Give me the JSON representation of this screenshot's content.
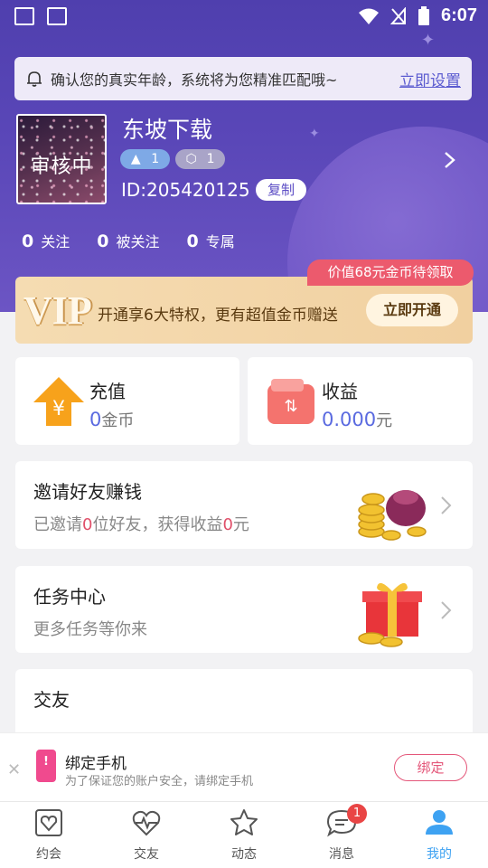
{
  "status_bar": {
    "time": "6:07"
  },
  "notice": {
    "text": "确认您的真实年龄，系统将为您精准匹配哦~",
    "link": "立即设置"
  },
  "profile": {
    "avatar_text": "审核中",
    "name": "东坡下载",
    "badge1": "1",
    "badge2": "1",
    "id": "ID:205420125",
    "copy": "复制"
  },
  "stats": [
    {
      "value": "0",
      "label": "关注"
    },
    {
      "value": "0",
      "label": "被关注"
    },
    {
      "value": "0",
      "label": "专属"
    }
  ],
  "vip": {
    "tag": "价值68元金币待领取",
    "logo": "VIP",
    "text": "开通享6大特权，更有超值金币赠送",
    "button": "立即开通"
  },
  "recharge": {
    "title": "充值",
    "value": "0",
    "unit": "金币"
  },
  "income": {
    "title": "收益",
    "value": "0.000",
    "unit": "元"
  },
  "invite": {
    "title": "邀请好友赚钱",
    "prefix": "已邀请",
    "count": "0",
    "mid": "位好友，获得收益",
    "amount": "0",
    "suffix": "元"
  },
  "task": {
    "title": "任务中心",
    "subtitle": "更多任务等你来"
  },
  "friends": {
    "title": "交友"
  },
  "bind": {
    "title": "绑定手机",
    "subtitle": "为了保证您的账户安全，请绑定手机",
    "button": "绑定"
  },
  "tabs": [
    {
      "label": "约会"
    },
    {
      "label": "交友"
    },
    {
      "label": "动态"
    },
    {
      "label": "消息",
      "badge": "1"
    },
    {
      "label": "我的"
    }
  ],
  "colors": {
    "hero": "#5a47b8",
    "accent": "#3ea2f2",
    "pink": "#e4577a"
  }
}
